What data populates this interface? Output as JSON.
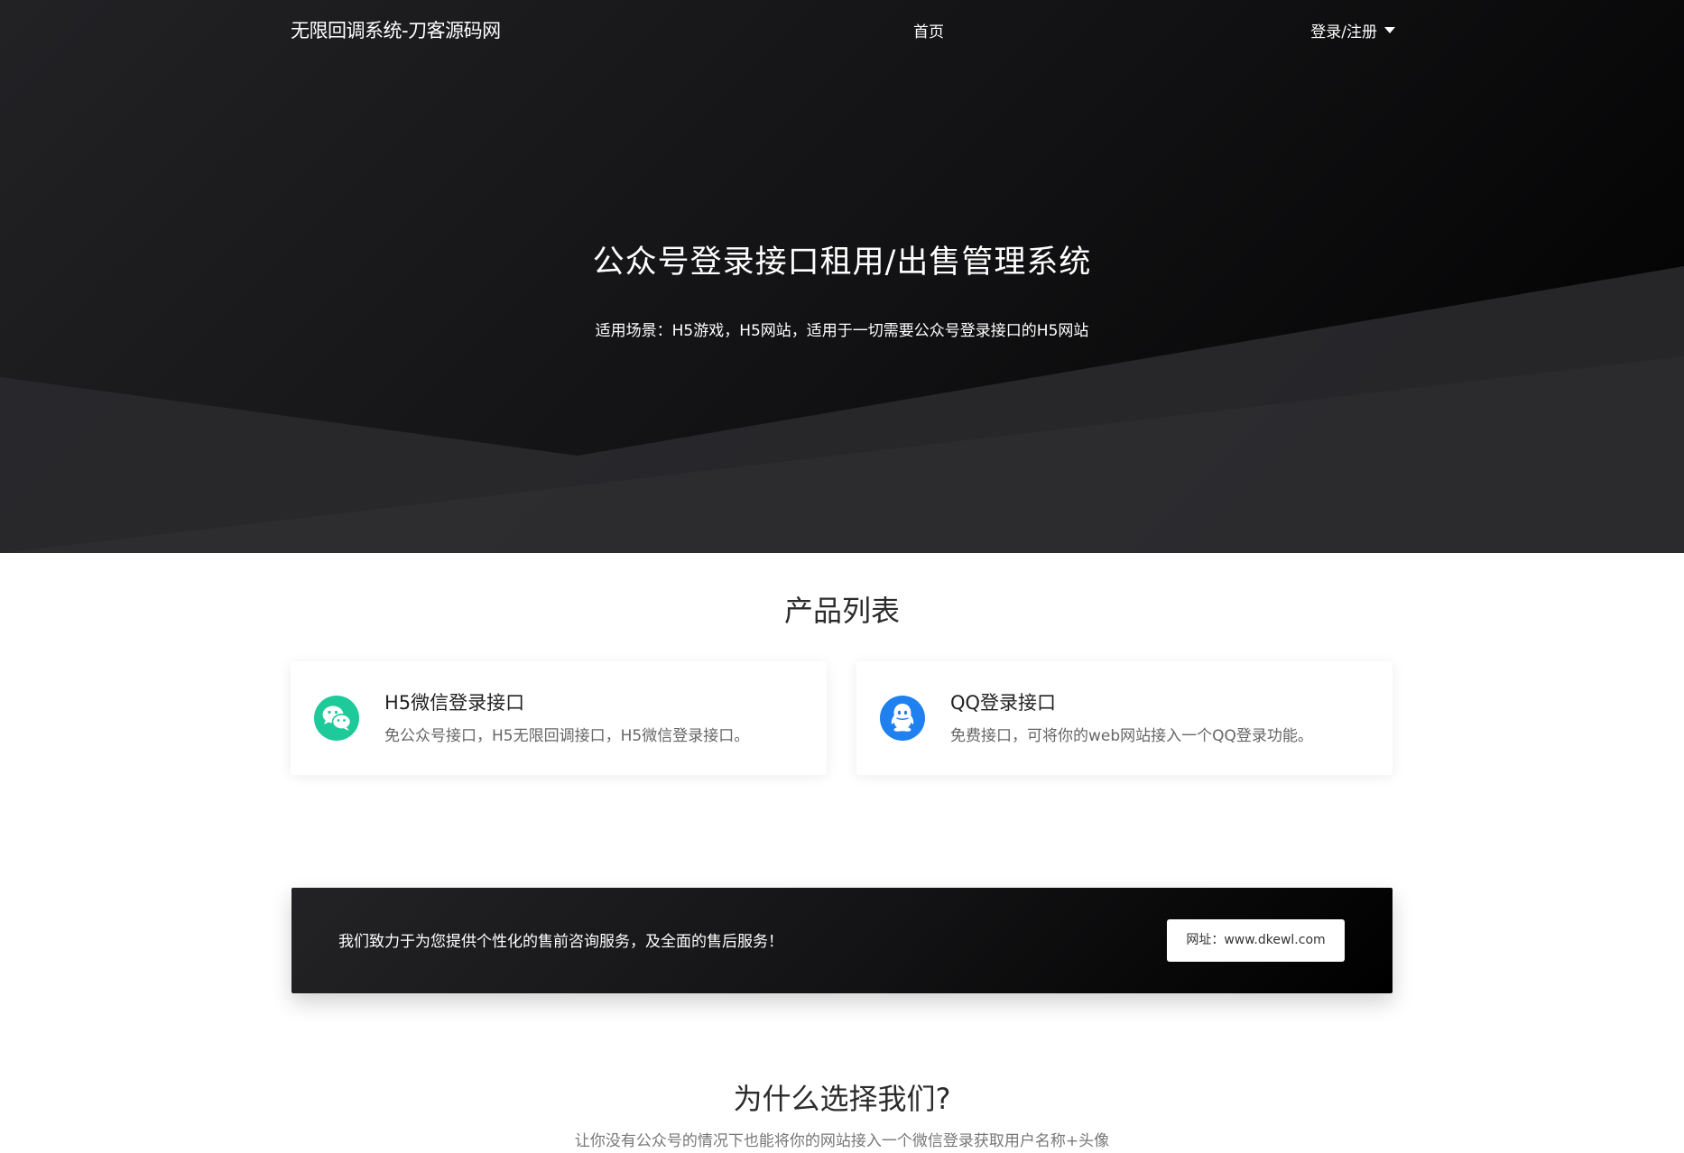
{
  "nav": {
    "brand": "无限回调系统-刀客源码网",
    "home": "首页",
    "login": "登录/注册"
  },
  "hero": {
    "title": "公众号登录接口租用/出售管理系统",
    "subtitle": "适用场景：H5游戏，H5网站，适用于一切需要公众号登录接口的H5网站"
  },
  "products": {
    "title": "产品列表",
    "items": [
      {
        "title": "H5微信登录接口",
        "desc": "免公众号接口，H5无限回调接口，H5微信登录接口。",
        "icon": "wechat-icon",
        "icon_color": "#1ec99a"
      },
      {
        "title": "QQ登录接口",
        "desc": "免费接口，可将你的web网站接入一个QQ登录功能。",
        "icon": "qq-icon",
        "icon_color": "#1f80f0"
      }
    ]
  },
  "cta": {
    "text": "我们致力于为您提供个性化的售前咨询服务，及全面的售后服务！",
    "button": "网址：www.dkewl.com"
  },
  "why": {
    "title": "为什么选择我们?",
    "subtitle": "让你没有公众号的情况下也能将你的网站接入一个微信登录获取用户名称+头像"
  }
}
